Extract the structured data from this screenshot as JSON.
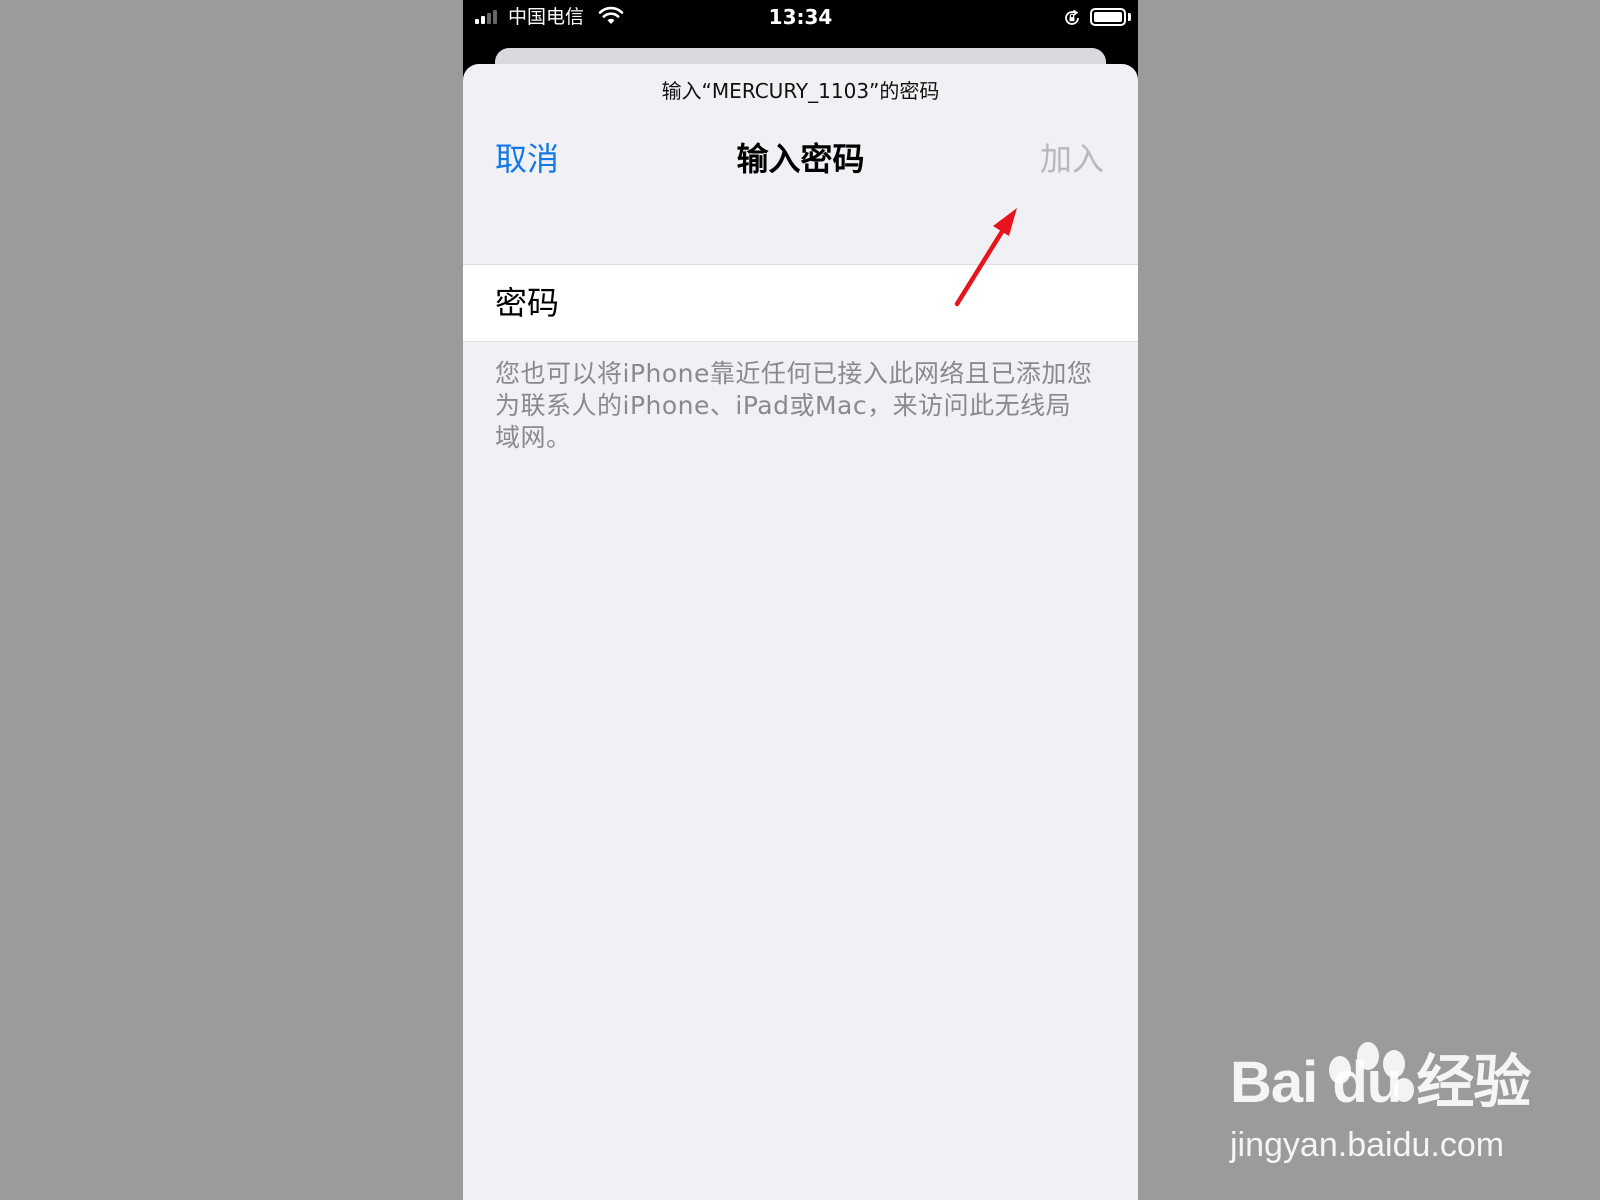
{
  "status_bar": {
    "carrier": "中国电信",
    "time": "13:34",
    "signal_icon": "signal-bars-icon",
    "wifi_icon": "wifi-icon",
    "orientation_lock_icon": "orientation-lock-icon",
    "battery_icon": "battery-icon"
  },
  "sheet": {
    "prompt": "输入“MERCURY_1103”的密码",
    "nav": {
      "cancel_label": "取消",
      "title": "输入密码",
      "join_label": "加入"
    },
    "password_field": {
      "label": "密码",
      "value": ""
    },
    "footnote": "您也可以将iPhone靠近任何已接入此网络且已添加您为联系人的iPhone、iPad或Mac，来访问此无线局域网。"
  },
  "annotation": {
    "arrow_icon": "red-arrow-icon",
    "arrow_color": "#e8141c"
  },
  "watermark": {
    "brand": "Bai du 经验",
    "url": "jingyan.baidu.com"
  },
  "colors": {
    "accent_blue": "#1479e6",
    "disabled_gray": "#b8b8bd",
    "sheet_bg": "#f1f1f5",
    "page_bg": "#9b9b9b"
  }
}
